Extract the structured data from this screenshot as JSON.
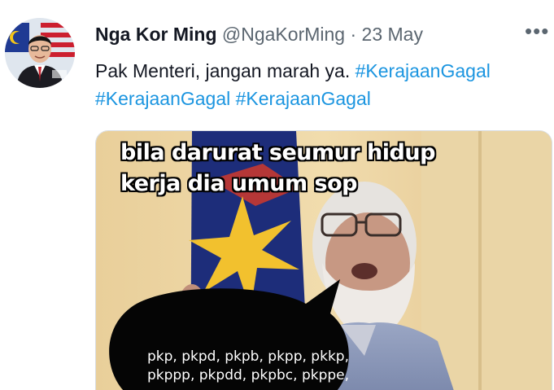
{
  "tweet": {
    "author_name": "Nga Kor Ming",
    "author_handle": "@NgaKorMing",
    "separator": "·",
    "date": "23 May",
    "more_icon": "more-horizontal-icon",
    "text": "Pak Menteri, jangan marah ya.",
    "hashtags": [
      "#KerajaanGagal",
      "#KerajaanGagal",
      "#KerajaanGagal"
    ]
  },
  "meme": {
    "caption_line1": "bila darurat seumur hidup",
    "caption_line2": "kerja dia umum sop",
    "bubble_line1": "pkp, pkpd, pkpb, pkpp, pkkp,",
    "bubble_line2": "pkppp, pkpdd, pkpbc, pkppe,"
  },
  "colors": {
    "hashtag": "#1b95e0",
    "name": "#141823",
    "meta": "#5b6670"
  }
}
